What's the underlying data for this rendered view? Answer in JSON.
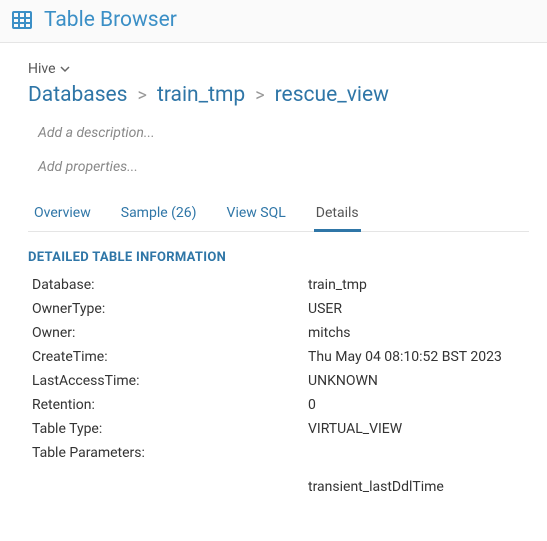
{
  "header": {
    "title": "Table Browser"
  },
  "source": {
    "label": "Hive"
  },
  "breadcrumb": {
    "root": "Databases",
    "db": "train_tmp",
    "table": "rescue_view"
  },
  "placeholders": {
    "add_description": "Add a description...",
    "add_properties": "Add properties..."
  },
  "tabs": {
    "overview": "Overview",
    "sample": "Sample (26)",
    "view_sql": "View SQL",
    "details": "Details"
  },
  "section": {
    "title": "DETAILED TABLE INFORMATION"
  },
  "details": {
    "database_label": "Database:",
    "database_value": "train_tmp",
    "ownertype_label": "OwnerType:",
    "ownertype_value": "USER",
    "owner_label": "Owner:",
    "owner_value": "mitchs",
    "createtime_label": "CreateTime:",
    "createtime_value": "Thu May 04 08:10:52 BST 2023",
    "lastaccess_label": "LastAccessTime:",
    "lastaccess_value": "UNKNOWN",
    "retention_label": "Retention:",
    "retention_value": "0",
    "tabletype_label": "Table Type:",
    "tabletype_value": "VIRTUAL_VIEW",
    "tableparams_label": "Table Parameters:",
    "tableparams_value": "",
    "param1_label": "",
    "param1_value": "transient_lastDdlTime"
  }
}
